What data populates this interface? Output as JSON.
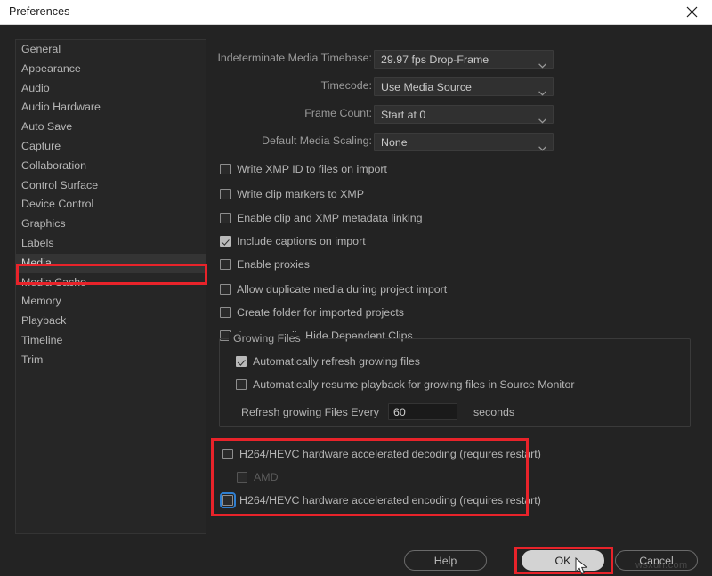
{
  "window": {
    "title": "Preferences",
    "close_icon": "close-icon"
  },
  "sidebar": {
    "items": [
      {
        "label": "General",
        "selected": false
      },
      {
        "label": "Appearance",
        "selected": false
      },
      {
        "label": "Audio",
        "selected": false
      },
      {
        "label": "Audio Hardware",
        "selected": false
      },
      {
        "label": "Auto Save",
        "selected": false
      },
      {
        "label": "Capture",
        "selected": false
      },
      {
        "label": "Collaboration",
        "selected": false
      },
      {
        "label": "Control Surface",
        "selected": false
      },
      {
        "label": "Device Control",
        "selected": false
      },
      {
        "label": "Graphics",
        "selected": false
      },
      {
        "label": "Labels",
        "selected": false
      },
      {
        "label": "Media",
        "selected": true
      },
      {
        "label": "Media Cache",
        "selected": false
      },
      {
        "label": "Memory",
        "selected": false
      },
      {
        "label": "Playback",
        "selected": false
      },
      {
        "label": "Timeline",
        "selected": false
      },
      {
        "label": "Trim",
        "selected": false
      }
    ]
  },
  "main": {
    "fields": [
      {
        "label": "Indeterminate Media Timebase:",
        "value": "29.97 fps Drop-Frame"
      },
      {
        "label": "Timecode:",
        "value": "Use Media Source"
      },
      {
        "label": "Frame Count:",
        "value": "Start at 0"
      },
      {
        "label": "Default Media Scaling:",
        "value": "None"
      }
    ],
    "checkboxes": [
      {
        "label": "Write XMP ID to files on import",
        "checked": false
      },
      {
        "label": "Write clip markers to XMP",
        "checked": false
      },
      {
        "label": "Enable clip and XMP metadata linking",
        "checked": false
      },
      {
        "label": "Include captions on import",
        "checked": true
      },
      {
        "label": "Enable proxies",
        "checked": false
      },
      {
        "label": "Allow duplicate media during project import",
        "checked": false
      },
      {
        "label": "Create folder for imported projects",
        "checked": false
      },
      {
        "label": "Automatically Hide Dependent Clips",
        "checked": false
      }
    ],
    "growing_files": {
      "legend": "Growing Files",
      "checkboxes": [
        {
          "label": "Automatically refresh growing files",
          "checked": true
        },
        {
          "label": "Automatically resume playback for growing files in Source Monitor",
          "checked": false
        }
      ],
      "refresh_label": "Refresh growing Files Every",
      "refresh_value": "60",
      "refresh_unit": "seconds"
    },
    "hardware": [
      {
        "label": "H264/HEVC hardware accelerated decoding (requires restart)",
        "checked": false,
        "disabled": false,
        "focused": false
      },
      {
        "label": "AMD",
        "checked": false,
        "disabled": true,
        "focused": false
      },
      {
        "label": "H264/HEVC hardware accelerated encoding (requires restart)",
        "checked": false,
        "disabled": false,
        "focused": true
      }
    ]
  },
  "footer": {
    "help": "Help",
    "ok": "OK",
    "cancel": "Cancel"
  },
  "overlay": {
    "watermark": "wsxdn.com",
    "cursor_icon": "mouse-pointer-icon",
    "annotation_color": "#e8232a",
    "focus_color": "#2f7fd1"
  }
}
